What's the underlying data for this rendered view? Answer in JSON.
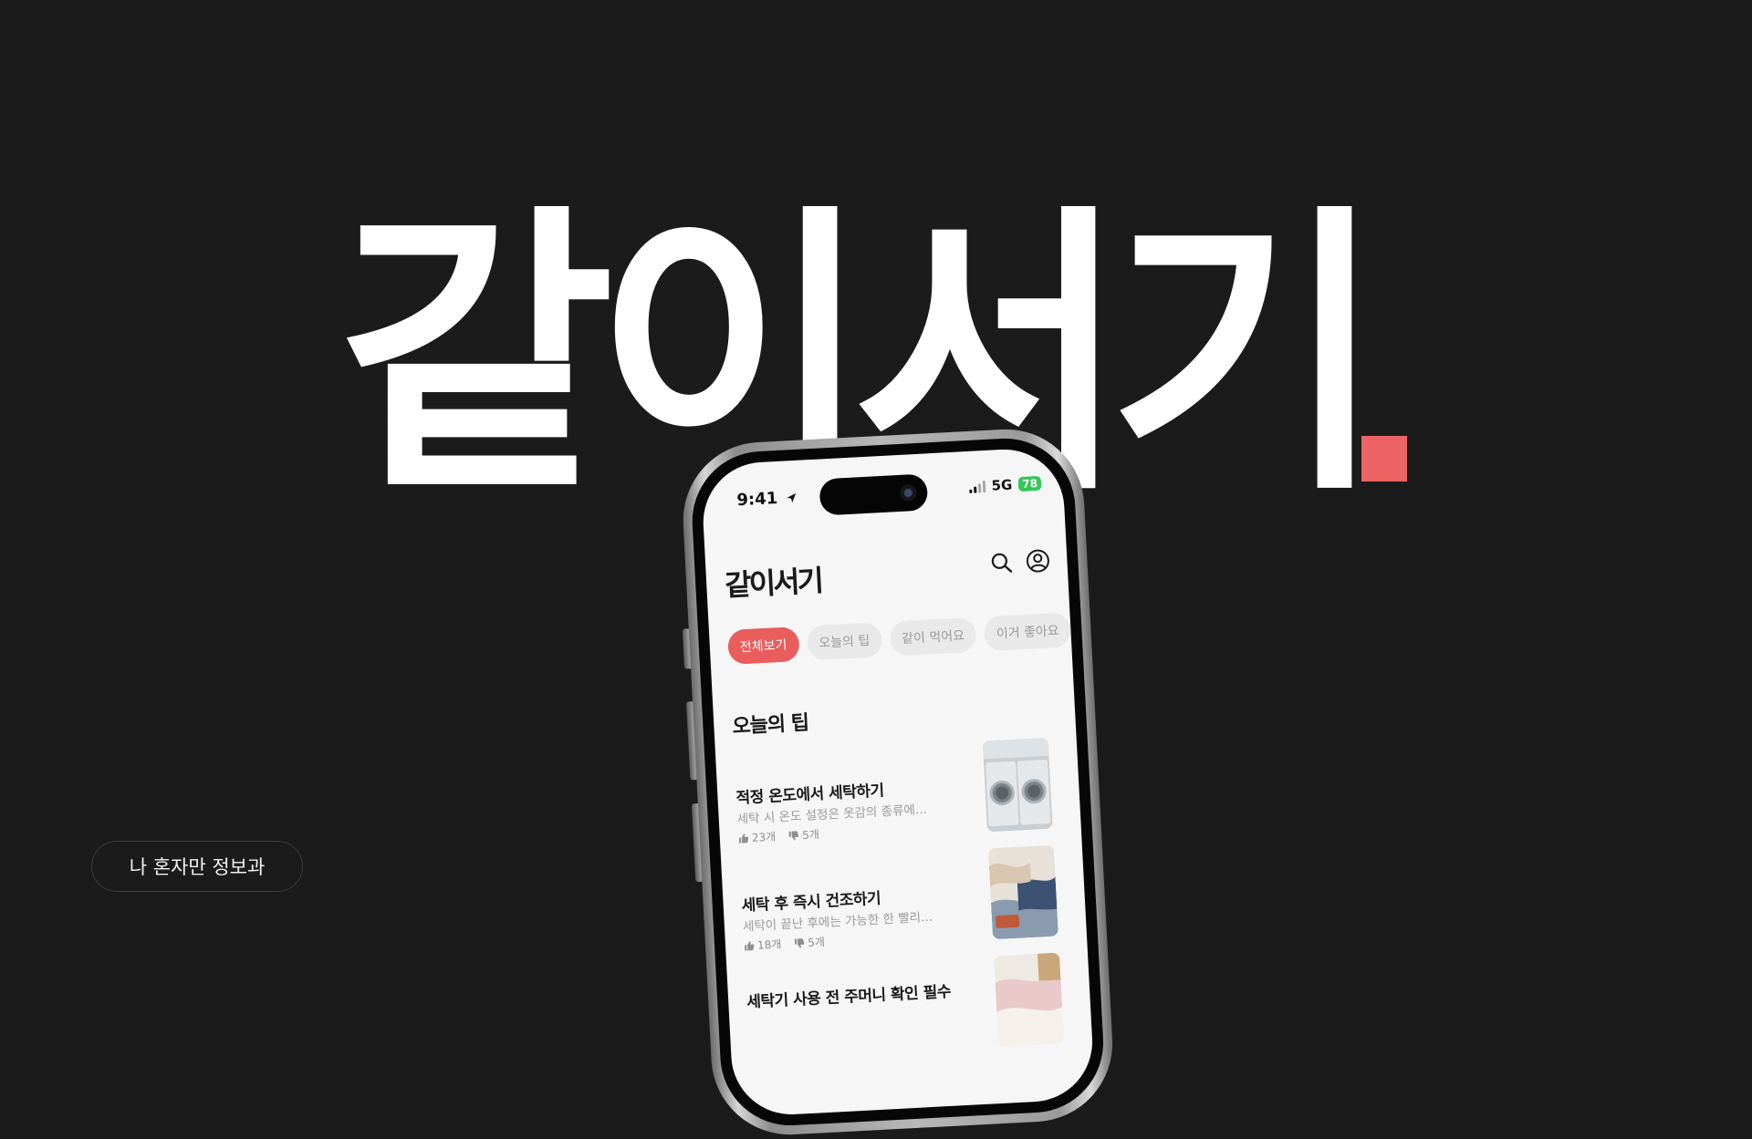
{
  "hero": {
    "title": "같이서기",
    "accent_color": "#ee6464"
  },
  "tagline": "나 혼자만 정보과",
  "phone": {
    "status_bar": {
      "time": "9:41",
      "network": "5G",
      "battery": "78"
    },
    "app": {
      "title": "같이서기",
      "search_icon": "search-icon",
      "profile_icon": "user-circle-icon",
      "chips": [
        {
          "label": "전체보기",
          "active": true
        },
        {
          "label": "오늘의 팁",
          "active": false
        },
        {
          "label": "같이 먹어요",
          "active": false
        },
        {
          "label": "이거 좋아요",
          "active": false
        }
      ],
      "section_title": "오늘의 팁",
      "tips": [
        {
          "title": "적정 온도에서 세탁하기",
          "desc": "세탁 시 온도 설정은 옷감의 종류에...",
          "likes": "23개",
          "dislikes": "5개",
          "thumb": "washing-machines"
        },
        {
          "title": "세탁 후 즉시 건조하기",
          "desc": "세탁이 끝난 후에는 가능한 한 빨리...",
          "likes": "18개",
          "dislikes": "5개",
          "thumb": "folded-laundry"
        },
        {
          "title": "세탁기 사용 전 주머니 확인 필수",
          "thumb": "towels"
        }
      ],
      "accent_color": "#e95d5d"
    }
  }
}
